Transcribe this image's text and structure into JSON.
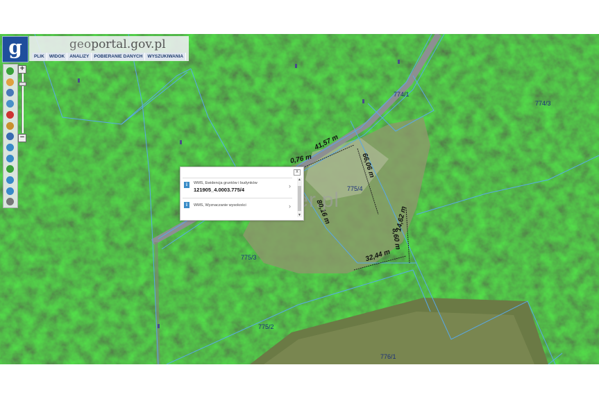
{
  "brand": {
    "logo_letter": "g",
    "title_part1": "geo",
    "title_part2": "portal.gov.pl"
  },
  "menu": [
    "PLIK",
    "WIDOK",
    "ANALIZY",
    "POBIERANIE DANYCH",
    "WYSZUKIWANIA"
  ],
  "toolbar": {
    "tools": [
      {
        "name": "info-icon",
        "color": "#3aa23a"
      },
      {
        "name": "pan-icon",
        "color": "#e0a040"
      },
      {
        "name": "legend-icon",
        "color": "#4a78b8"
      },
      {
        "name": "layers-icon",
        "color": "#4a90c8"
      },
      {
        "name": "print-icon",
        "color": "#cc3333"
      },
      {
        "name": "measure-icon",
        "color": "#c89030"
      },
      {
        "name": "xyz-icon",
        "color": "#3a6ab0"
      },
      {
        "name": "zoom-in-tool-icon",
        "color": "#3a8ac8"
      },
      {
        "name": "zoom-out-tool-icon",
        "color": "#3a8ac8"
      },
      {
        "name": "globe-icon",
        "color": "#3aa23a"
      },
      {
        "name": "back-arrow-icon",
        "color": "#3a8ac8"
      },
      {
        "name": "forward-arrow-icon",
        "color": "#3a8ac8"
      },
      {
        "name": "clear-icon",
        "color": "#777777"
      }
    ],
    "zoom_in": "+",
    "zoom_out": "−"
  },
  "parcels": [
    "774/1",
    "774/3",
    "775/4",
    "775/3",
    "775/2",
    "776/1"
  ],
  "dimensions": [
    "41,57 m",
    "0,76 m",
    "66,06 m",
    "80,16 m",
    "14,62 m",
    "8,60 m",
    "32,44 m"
  ],
  "popup": {
    "close": "x",
    "row1": {
      "source": "WMS, Ewidencja gruntów i budynków",
      "value": "121905_4.0003.775/4"
    },
    "row2": {
      "source": "WMS, Wyznaczanie wysokości"
    }
  },
  "watermark": "aBroker.pl"
}
